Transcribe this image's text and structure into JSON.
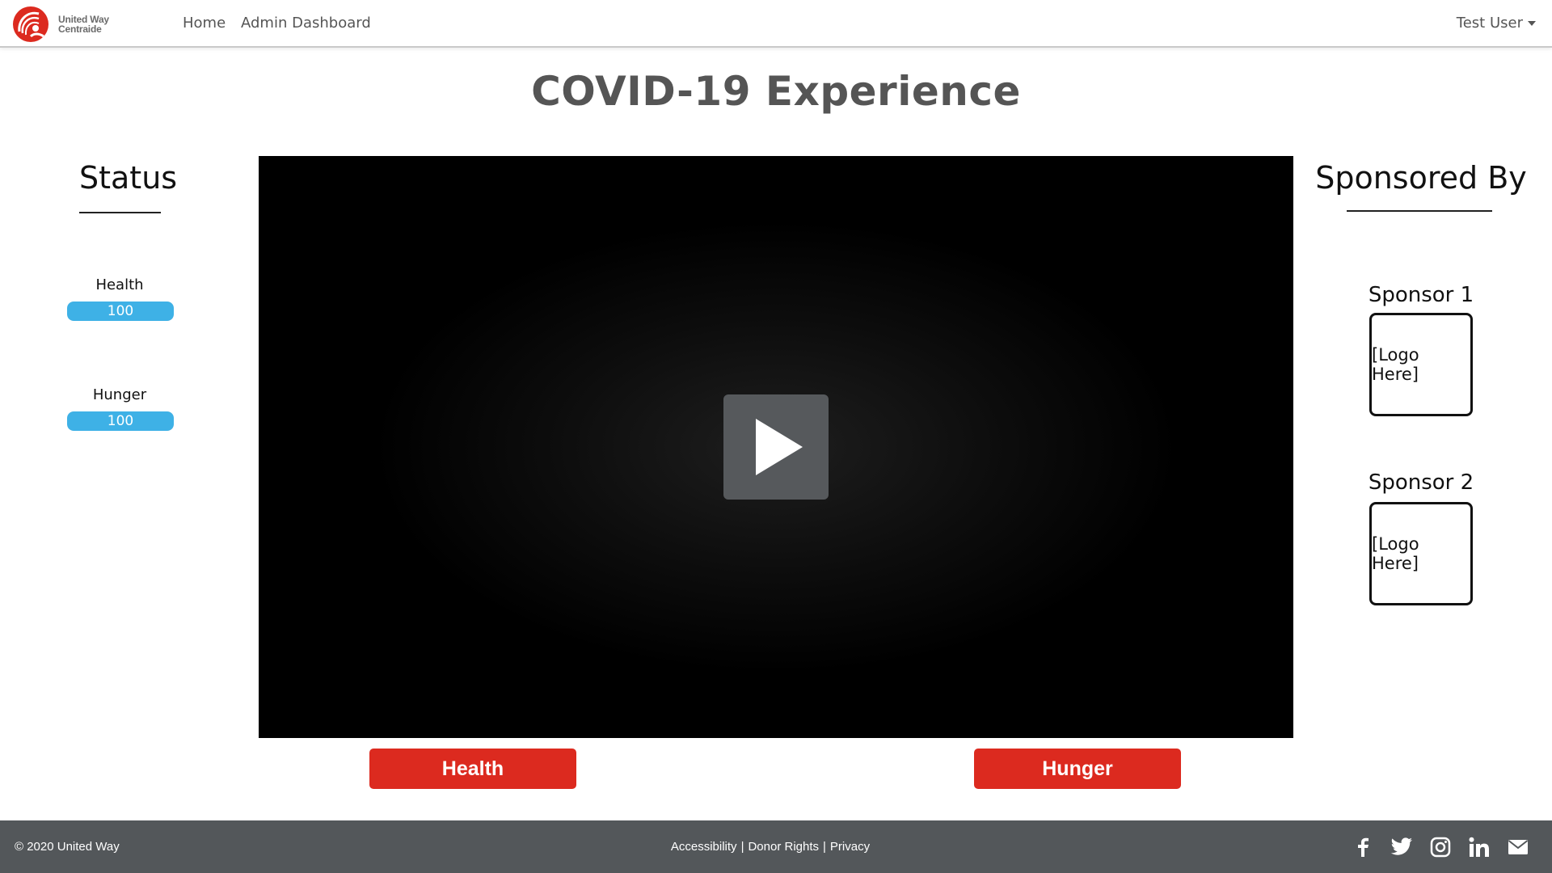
{
  "brand": {
    "line1": "United Way",
    "line2": "Centraide",
    "color": "#dc2a1f"
  },
  "nav": {
    "home": "Home",
    "admin": "Admin Dashboard",
    "user": "Test User"
  },
  "page": {
    "title": "COVID-19 Experience"
  },
  "status": {
    "heading": "Status",
    "stats": [
      {
        "label": "Health",
        "value": "100",
        "fraction": 1.0
      },
      {
        "label": "Hunger",
        "value": "100",
        "fraction": 1.0
      }
    ]
  },
  "choices": {
    "health": "Health",
    "hunger": "Hunger"
  },
  "sponsors": {
    "heading": "Sponsored By",
    "items": [
      {
        "name": "Sponsor 1",
        "logo": "[Logo Here]"
      },
      {
        "name": "Sponsor 2",
        "logo": "[Logo Here]"
      }
    ]
  },
  "footer": {
    "copyright": "© 2020 United Way",
    "links": [
      "Accessibility",
      "Donor Rights",
      "Privacy"
    ],
    "social": [
      "facebook-icon",
      "twitter-icon",
      "instagram-icon",
      "linkedin-icon",
      "email-icon"
    ]
  },
  "colors": {
    "accent_red": "#dc2a1f",
    "stat_blue": "#3eb1e6",
    "footer_bg": "#53575a"
  }
}
